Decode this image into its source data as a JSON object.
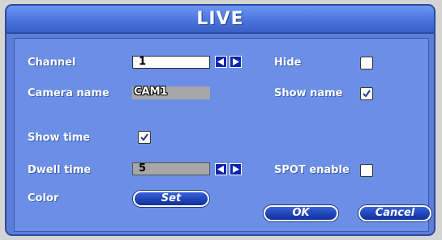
{
  "window": {
    "title": "LIVE"
  },
  "form": {
    "channel": {
      "label": "Channel",
      "value": "1"
    },
    "camera_name": {
      "label": "Camera name",
      "value": "CAM1"
    },
    "show_time": {
      "label": "Show time",
      "checked": true
    },
    "dwell_time": {
      "label": "Dwell time",
      "value": "5"
    },
    "color": {
      "label": "Color",
      "button": "Set"
    },
    "hide": {
      "label": "Hide",
      "checked": false
    },
    "show_name": {
      "label": "Show name",
      "checked": true
    },
    "spot_enable": {
      "label": "SPOT enable",
      "checked": false
    }
  },
  "buttons": {
    "ok": "OK",
    "cancel": "Cancel"
  },
  "icons": {
    "prev": "triangle-left-icon",
    "next": "triangle-right-icon",
    "check": "check-icon"
  },
  "colors": {
    "background": "#5b7fd6",
    "panel": "#6b8fe6",
    "arrow_button": "#0a24b0",
    "button": "#1f45b8"
  }
}
